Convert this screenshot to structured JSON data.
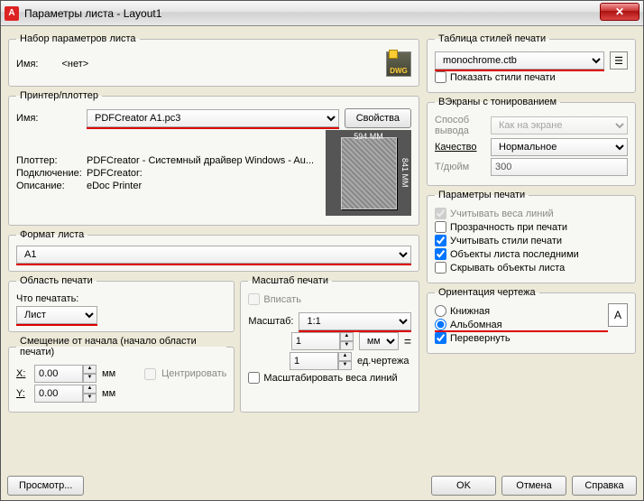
{
  "window": {
    "title": "Параметры листа - Layout1"
  },
  "pageset": {
    "legend": "Набор параметров листа",
    "name_label": "Имя:",
    "name_value": "<нет>"
  },
  "plotstyle": {
    "legend": "Таблица стилей печати",
    "value": "monochrome.ctb",
    "show_styles": "Показать стили печати"
  },
  "printer": {
    "legend": "Принтер/плоттер",
    "name_label": "Имя:",
    "name_value": "PDFCreator A1.pc3",
    "props_btn": "Свойства",
    "plotter_label": "Плоттер:",
    "plotter_value": "PDFCreator - Системный драйвер Windows - Au...",
    "conn_label": "Подключение:",
    "conn_value": "PDFCreator:",
    "desc_label": "Описание:",
    "desc_value": "eDoc Printer",
    "preview_w": "594 MM",
    "preview_h": "841 MM"
  },
  "viewports": {
    "legend": "ВЭкраны с тонированием",
    "mode_label": "Способ вывода",
    "mode_value": "Как на экране",
    "quality_label": "Качество",
    "quality_value": "Нормальное",
    "dpi_label": "Т/дюйм",
    "dpi_value": "300"
  },
  "paper": {
    "legend": "Формат листа",
    "value": "A1"
  },
  "plotarea": {
    "legend": "Область печати",
    "what_label": "Что печатать:",
    "what_value": "Лист"
  },
  "offset": {
    "legend": "Смещение от начала (начало области печати)",
    "x_label": "X:",
    "x_value": "0.00",
    "y_label": "Y:",
    "y_value": "0.00",
    "unit": "мм",
    "center": "Центрировать"
  },
  "scale": {
    "legend": "Масштаб печати",
    "fit": "Вписать",
    "scale_label": "Масштаб:",
    "scale_value": "1:1",
    "num_value": "1",
    "num_unit": "мм",
    "den_value": "1",
    "den_unit": "ед.чертежа",
    "scale_lw": "Масштабировать веса линий"
  },
  "options": {
    "legend": "Параметры печати",
    "opt1": "Учитывать веса линий",
    "opt2": "Прозрачность при печати",
    "opt3": "Учитывать стили печати",
    "opt4": "Объекты листа последними",
    "opt5": "Скрывать объекты листа"
  },
  "orient": {
    "legend": "Ориентация чертежа",
    "portrait": "Книжная",
    "landscape": "Альбомная",
    "upside": "Перевернуть"
  },
  "buttons": {
    "preview": "Просмотр...",
    "ok": "OK",
    "cancel": "Отмена",
    "help": "Справка"
  }
}
